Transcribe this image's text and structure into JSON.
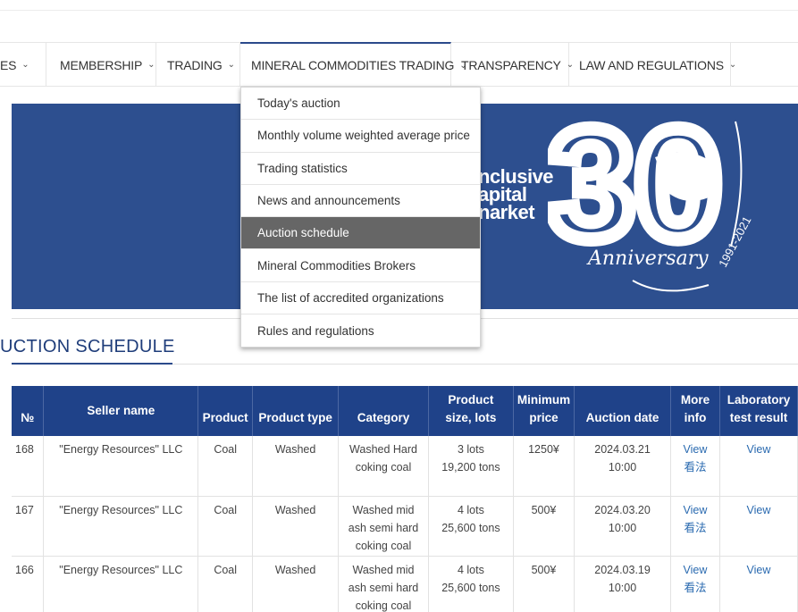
{
  "nav": {
    "items": [
      {
        "label": "ES",
        "chevron": "chevron-down-icon"
      },
      {
        "label": "MEMBERSHIP",
        "chevron": "chevron-down-icon"
      },
      {
        "label": "TRADING",
        "chevron": "chevron-down-icon"
      },
      {
        "label": "MINERAL COMMODITIES TRADING",
        "chevron": "chevron-down-icon"
      },
      {
        "label": "TRANSPARENCY",
        "chevron": "chevron-down-icon"
      },
      {
        "label": "LAW AND REGULATIONS",
        "chevron": "chevron-down-icon"
      }
    ],
    "chevron_glyph": "⌄"
  },
  "dropdown": {
    "items": [
      {
        "label": "Today's auction"
      },
      {
        "label": "Monthly volume weighted average price"
      },
      {
        "label": "Trading statistics"
      },
      {
        "label": "News and announcements"
      },
      {
        "label": "Auction schedule"
      },
      {
        "label": "Mineral Commodities Brokers"
      },
      {
        "label": "The list of accredited organizations"
      },
      {
        "label": "Rules and regulations"
      }
    ],
    "selected_index": 4
  },
  "banner": {
    "line1": "nclusive",
    "line2": "apital",
    "line3": "narket",
    "big_number": "30",
    "years": "1991-2021",
    "script": "Anniversary",
    "bg_color": "#2d4f8f"
  },
  "page": {
    "title": "UCTION SCHEDULE"
  },
  "table": {
    "headers": {
      "no": "№",
      "seller": "Seller name",
      "product": "Product",
      "type": "Product type",
      "category": "Category",
      "size_1": "Product",
      "size_2": "size, lots",
      "price_1": "Minimum",
      "price_2": "price",
      "date": "Auction date",
      "info_1": "More",
      "info_2": "info",
      "lab_1": "Laboratory",
      "lab_2": "test result"
    },
    "rows": [
      {
        "no": "168",
        "seller": "\"Energy Resources\" LLC",
        "product": "Coal",
        "type": "Washed",
        "category_1": "Washed Hard",
        "category_2": "coking coal",
        "category_3": "",
        "size_1": "3 lots",
        "size_2": "19,200 tons",
        "price": "1250¥",
        "date_1": "2024.03.21",
        "date_2": "10:00",
        "info_1": "View",
        "info_2": "看法",
        "lab": "View"
      },
      {
        "no": "167",
        "seller": "\"Energy Resources\" LLC",
        "product": "Coal",
        "type": "Washed",
        "category_1": "Washed mid",
        "category_2": "ash semi hard",
        "category_3": "coking coal",
        "size_1": "4 lots",
        "size_2": "25,600 tons",
        "price": "500¥",
        "date_1": "2024.03.20",
        "date_2": "10:00",
        "info_1": "View",
        "info_2": "看法",
        "lab": "View"
      },
      {
        "no": "166",
        "seller": "\"Energy Resources\" LLC",
        "product": "Coal",
        "type": "Washed",
        "category_1": "Washed mid",
        "category_2": "ash semi hard",
        "category_3": "coking coal",
        "size_1": "4 lots",
        "size_2": "25,600 tons",
        "price": "500¥",
        "date_1": "2024.03.19",
        "date_2": "10:00",
        "info_1": "View",
        "info_2": "看法",
        "lab": "View"
      }
    ]
  }
}
